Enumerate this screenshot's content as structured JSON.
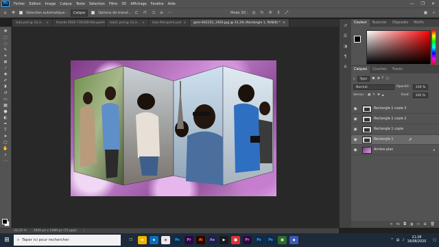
{
  "app": {
    "logo": "Ps"
  },
  "menu": [
    "Fichier",
    "Edition",
    "Image",
    "Calque",
    "Texte",
    "Sélection",
    "Filtre",
    "3D",
    "Affichage",
    "Fenêtre",
    "Aide"
  ],
  "window_controls": [
    "—",
    "❐",
    "✕"
  ],
  "options": {
    "auto_select_label": "Sélection automatique :",
    "auto_select_target": "Calque",
    "transform_label": "Options de transf...",
    "mode_3d_label": "Mode 3D :"
  },
  "tabs": [
    {
      "label": "tuto.psd @ 33,3...",
      "close": "×"
    },
    {
      "label": "thumb-1920-735358-Récupéré.psd",
      "close": "×"
    },
    {
      "label": "tuto1.psd @ 33,3...",
      "close": "×"
    },
    {
      "label": "tuto-Récupéré.psd",
      "close": "×"
    },
    {
      "label": "gem-602252_1920.jpg @ 33,3% (Rectangle 1, RVB/8) *",
      "close": "×"
    }
  ],
  "status": {
    "zoom": "33,33 %",
    "doc_info": "1920 px x 1280 px (72 ppp)"
  },
  "color_panel": {
    "tabs": [
      "Couleur",
      "Nuancier",
      "Dégradés",
      "Motifs"
    ]
  },
  "layers_panel": {
    "tabs": [
      "Calques",
      "Couches",
      "Tracés"
    ],
    "filter_label": "Type",
    "blend_mode": "Normal",
    "opacity_label": "Opacité :",
    "opacity_value": "100 %",
    "lock_label": "Verrou :",
    "fill_label": "Fond :",
    "fill_value": "100 %",
    "layers": [
      {
        "name": "Rectangle 1 copie 3",
        "selected": false
      },
      {
        "name": "Rectangle 1 copie 2",
        "selected": false
      },
      {
        "name": "Rectangle 1 copie",
        "selected": false
      },
      {
        "name": "Rectangle 1",
        "selected": true
      },
      {
        "name": "Arrière-plan",
        "selected": false
      }
    ]
  },
  "taskbar": {
    "search_placeholder": "Taper ici pour rechercher",
    "apps": [
      "Ps",
      "Pr",
      "Ai",
      "Ae",
      "Pr",
      "Ps",
      "Ps"
    ],
    "time": "21:28",
    "date": "16/08/2020"
  }
}
